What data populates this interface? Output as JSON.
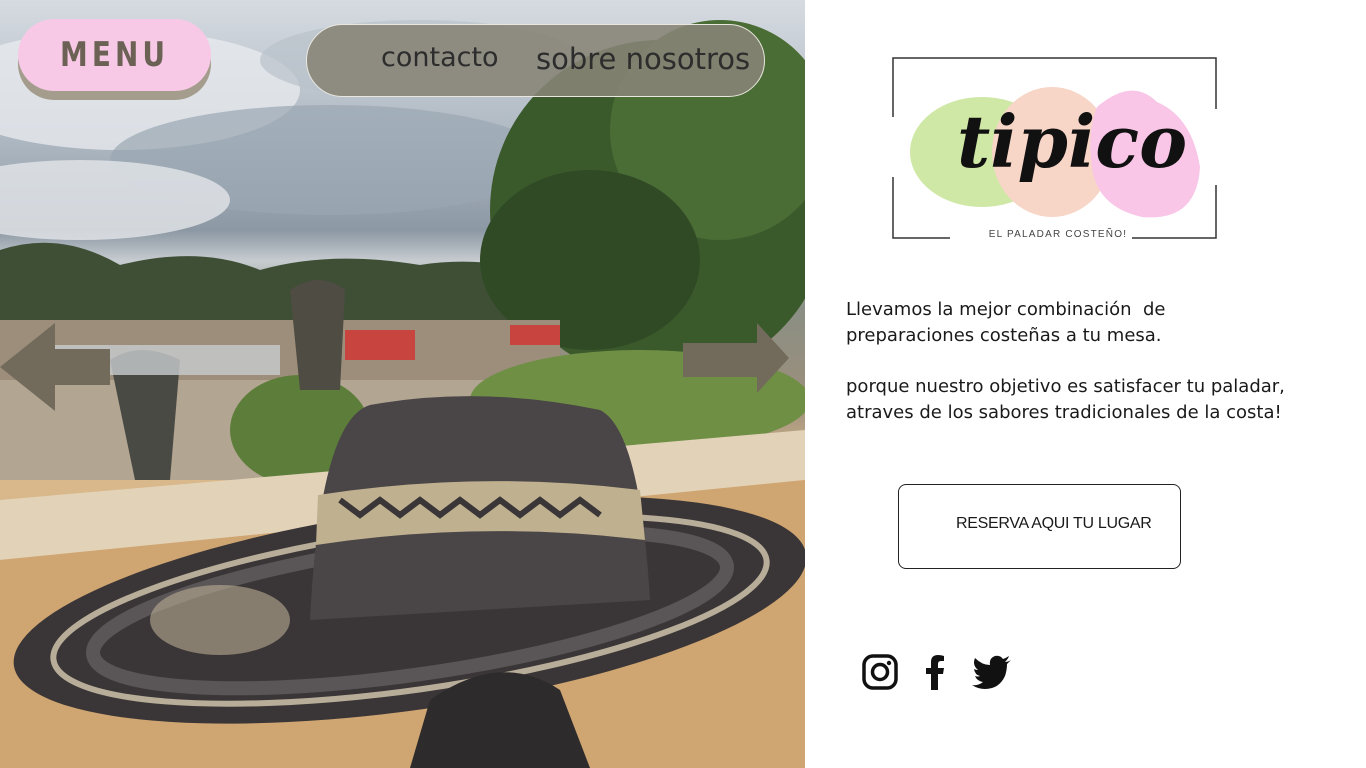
{
  "nav": {
    "menu_label": "MENU",
    "links": [
      {
        "label": "contacto"
      },
      {
        "label": "sobre nosotros"
      }
    ]
  },
  "brand": {
    "name": "tipico",
    "tagline": "EL PALADAR COSTEÑO!",
    "blob_colors": [
      "#cfe8a6",
      "#f7d5c7",
      "#f9c6e7"
    ]
  },
  "content": {
    "line1": "Llevamos la mejor combinación  de",
    "line2": "preparaciones costeñas a tu mesa.",
    "line3": "porque nuestro objetivo es satisfacer tu paladar,",
    "line4": "atraves de los sabores tradicionales de la costa!"
  },
  "cta": {
    "label": "RESERVA AQUI TU LUGAR"
  },
  "social": [
    {
      "icon": "instagram-icon"
    },
    {
      "icon": "facebook-icon"
    },
    {
      "icon": "twitter-icon"
    }
  ],
  "hero": {
    "image": "sombrero vueltiao photo",
    "arrow_color": "#726b5c",
    "nav_pill_color": "#888476",
    "menu_color": "#f7c9e6"
  }
}
